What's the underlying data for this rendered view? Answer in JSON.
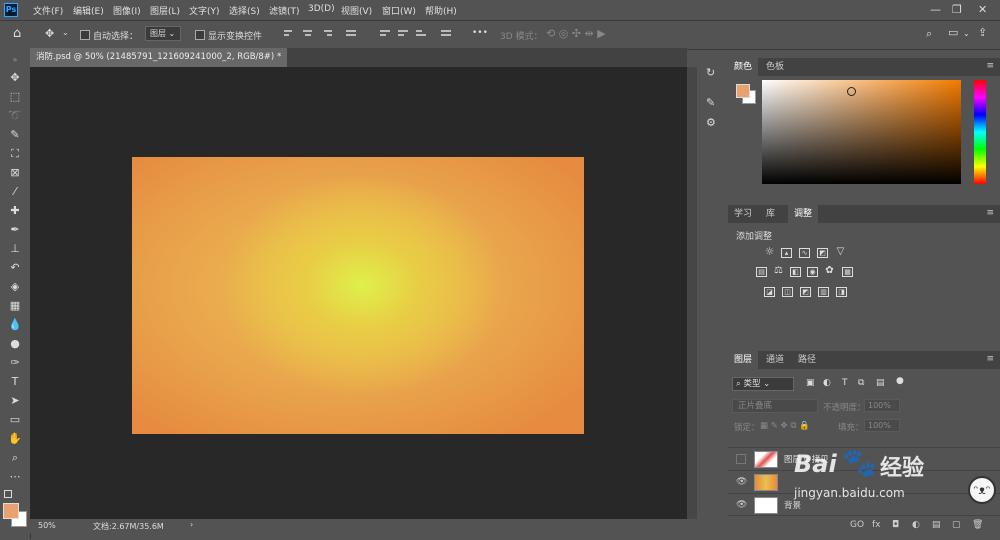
{
  "app": {
    "logo": "Ps"
  },
  "menu": [
    "文件(F)",
    "编辑(E)",
    "图像(I)",
    "图层(L)",
    "文字(Y)",
    "选择(S)",
    "滤镜(T)",
    "3D(D)",
    "视图(V)",
    "窗口(W)",
    "帮助(H)"
  ],
  "window_controls": {
    "minimize": "—",
    "restore": "❐",
    "close": "✕"
  },
  "options_bar": {
    "auto_select_label": "自动选择：",
    "layer_select_value": "图层",
    "show_transform_label": "显示变换控件",
    "more": "•••",
    "mode_3d_label": "3D 模式："
  },
  "document": {
    "tab_title": "消防.psd @ 50% (21485791_121609241000_2, RGB/8#) *",
    "tab_close": "×",
    "zoom": "50%",
    "doc_info": "文档:2.67M/35.6M",
    "status_arrow": "›"
  },
  "panels": {
    "color": {
      "tabs": [
        "颜色",
        "色板"
      ],
      "active": "颜色"
    },
    "adjust": {
      "tabs": [
        "学习",
        "库",
        "调整"
      ],
      "active": "调整",
      "title": "添加调整"
    },
    "layers": {
      "tabs": [
        "图层",
        "通道",
        "路径"
      ],
      "active": "图层",
      "filter_value": "类型",
      "blend_mode": "正片叠底",
      "opacity_label": "不透明度：",
      "opacity_value": "100%",
      "lock_label": "锁定：",
      "fill_label": "填充：",
      "fill_value": "100%",
      "rows": [
        {
          "name": "图层 0 拷贝",
          "visible": false,
          "swatch": "#e05050"
        },
        {
          "name": "",
          "visible": true,
          "swatch": "#e69a48"
        },
        {
          "name": "背景",
          "visible": true,
          "swatch": "#ffffff"
        }
      ],
      "footer": [
        "GO",
        "fx",
        "◘",
        "◐",
        "▤",
        "▢",
        "🗑"
      ]
    }
  },
  "watermark": {
    "brand": "Bai",
    "brand2": "经验",
    "url": "jingyan.baidu.com"
  },
  "colors": {
    "foreground": "#e9a26f",
    "background": "#ffffff",
    "accent": "#31a8ff"
  }
}
